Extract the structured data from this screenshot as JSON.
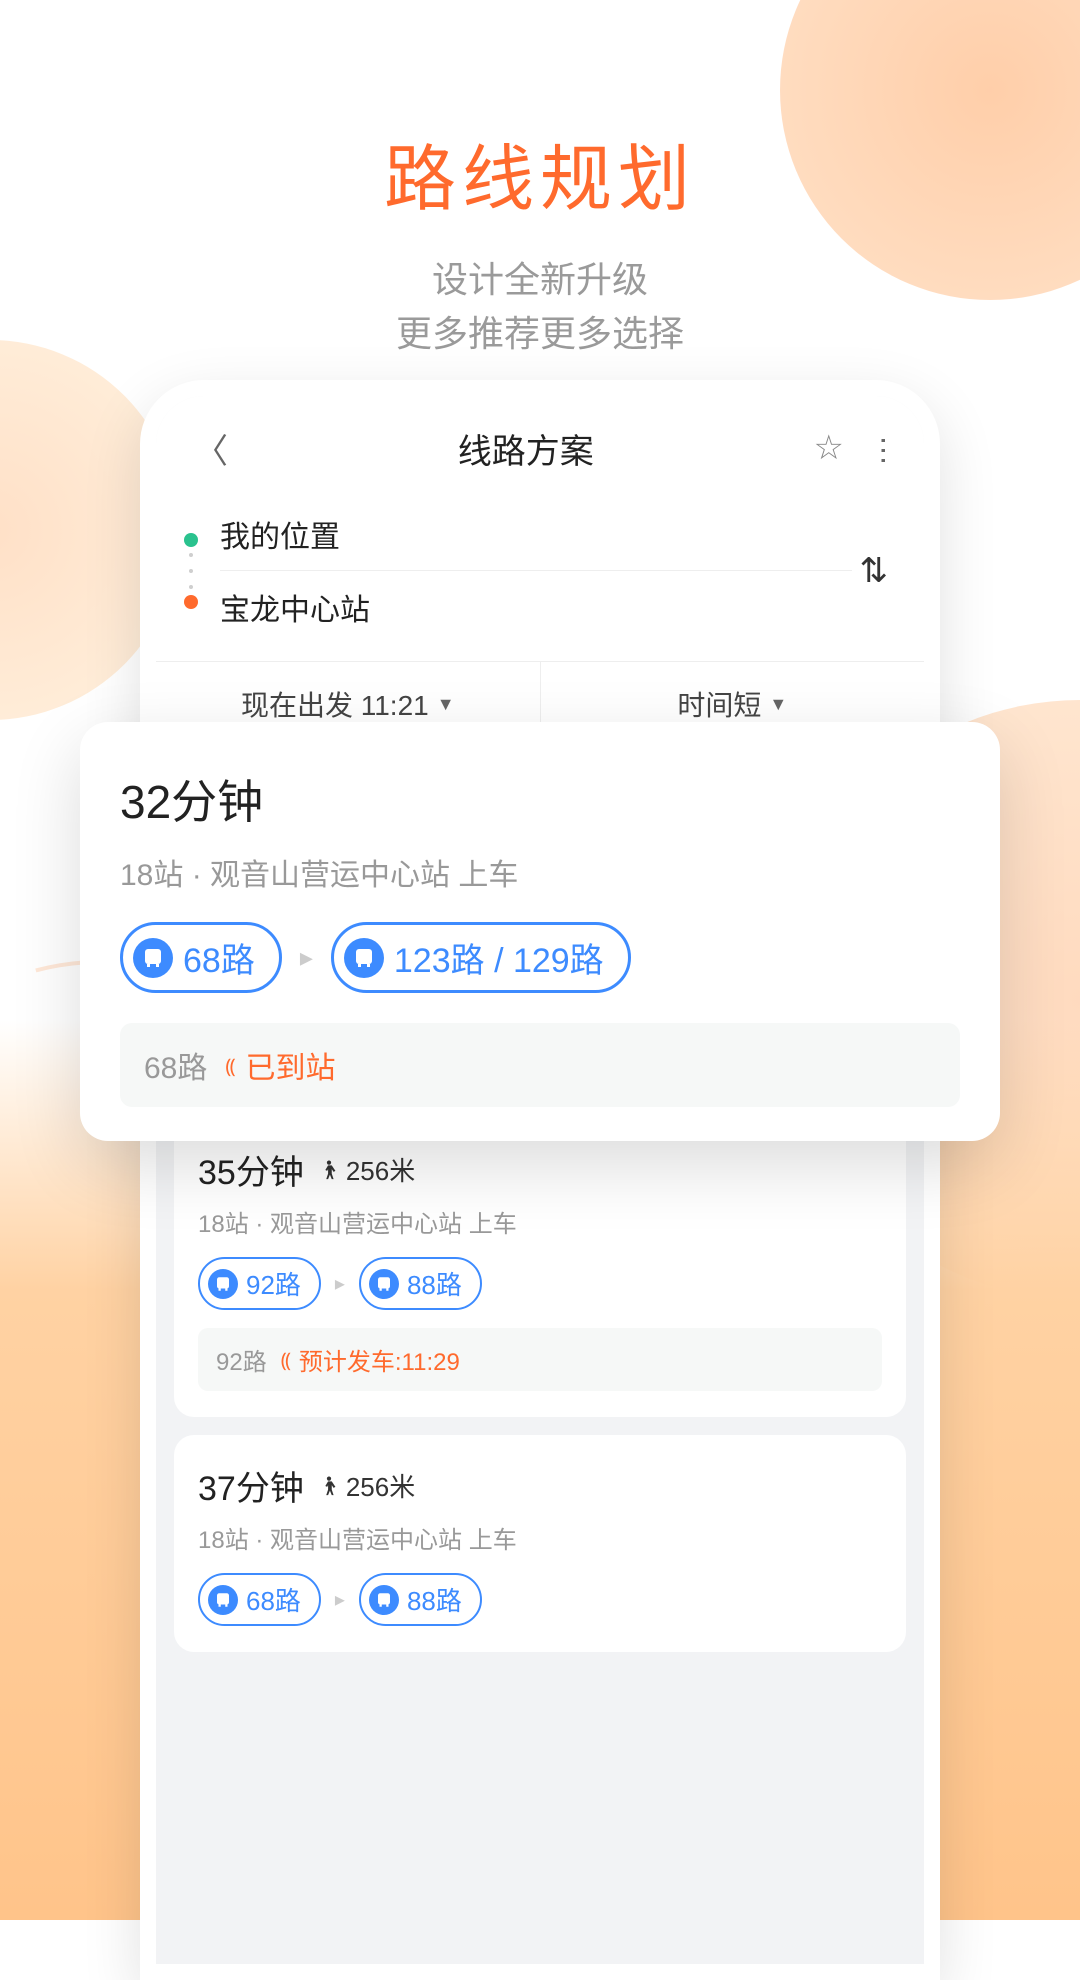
{
  "marketing": {
    "title": "路线规划",
    "sub1": "设计全新升级",
    "sub2": "更多推荐更多选择"
  },
  "nav": {
    "title": "线路方案"
  },
  "locations": {
    "from": "我的位置",
    "to": "宝龙中心站"
  },
  "filters": {
    "depart": "现在出发 11:21",
    "sort": "时间短"
  },
  "highlight": {
    "time": "32分钟",
    "meta": "18站  ·  观音山营运中心站   上车",
    "bus1": "68路",
    "bus2": "123路 / 129路",
    "status_route": "68路",
    "status_text": "已到站"
  },
  "routes": [
    {
      "time": "",
      "meta": "",
      "bus1": "",
      "bus2": "",
      "status_route": "68路",
      "status_text": "已到站"
    },
    {
      "time": "35分钟",
      "walk": "256米",
      "meta": "18站  ·  观音山营运中心站   上车",
      "bus1": "92路",
      "bus2": "88路",
      "status_route": "92路",
      "status_text": "预计发车:11:29"
    },
    {
      "time": "37分钟",
      "walk": "256米",
      "meta": "18站  ·  观音山营运中心站   上车",
      "bus1": "68路",
      "bus2": "88路"
    }
  ]
}
